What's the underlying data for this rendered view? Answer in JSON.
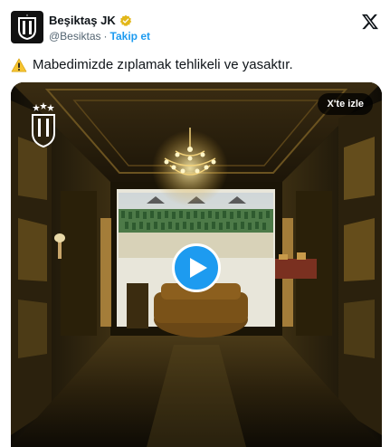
{
  "account": {
    "name": "Beşiktaş JK",
    "handle": "@Besiktas",
    "separator": "·",
    "follow_label": "Takip et"
  },
  "tweet": {
    "text": "Mabedimizde zıplamak tehlikeli ve yasaktır."
  },
  "media": {
    "watch_label": "X'te izle"
  },
  "colors": {
    "accent": "#1d9bf0",
    "text": "#0f1419",
    "secondary_text": "#536471"
  },
  "icons": [
    "verified-badge-icon",
    "x-logo-icon",
    "warning-icon",
    "play-icon",
    "club-crest-icon"
  ]
}
